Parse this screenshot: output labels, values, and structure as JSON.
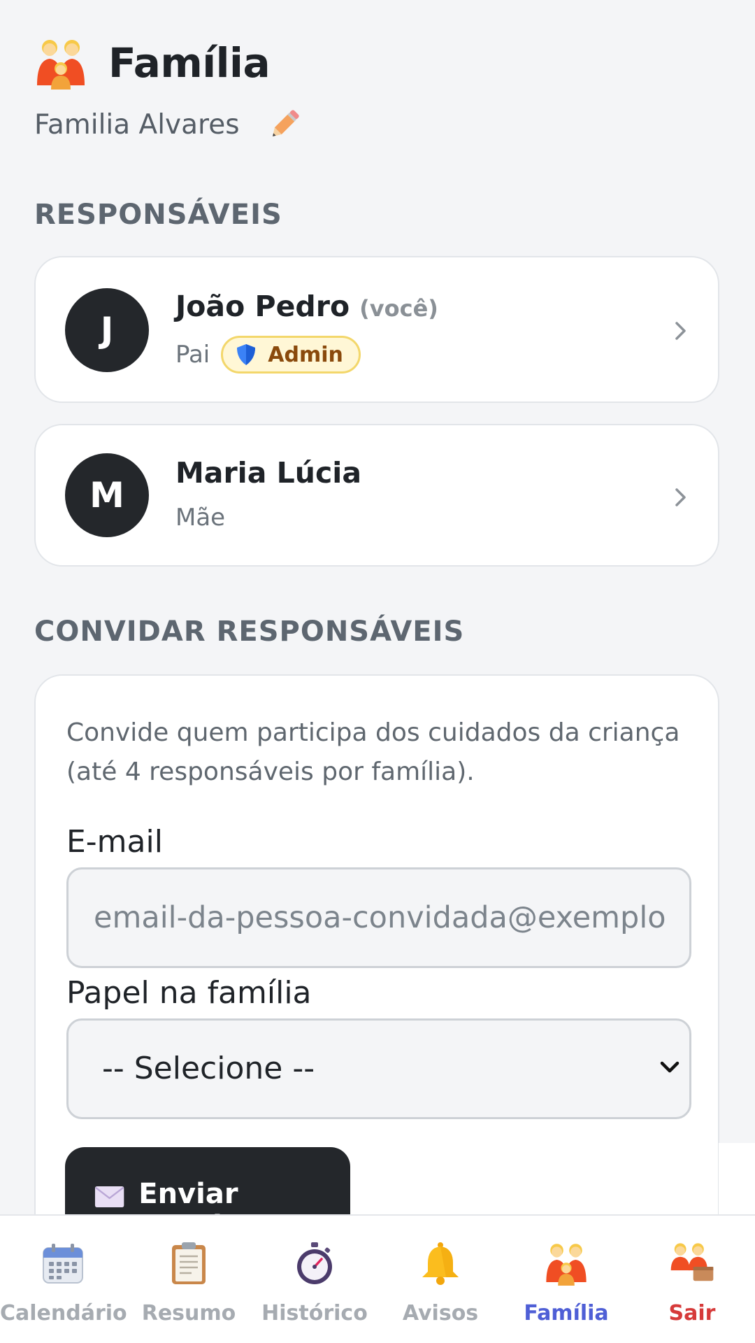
{
  "header": {
    "title": "Família",
    "icon": "family-icon",
    "family_name": "Familia Alvares",
    "edit_icon": "pencil-icon"
  },
  "responsaveis": {
    "section_title": "RESPONSÁVEIS",
    "members": [
      {
        "initial": "J",
        "name": "João Pedro",
        "you_label": "(você)",
        "role": "Pai",
        "badge": "Admin",
        "badge_icon": "shield-icon"
      },
      {
        "initial": "M",
        "name": "Maria Lúcia",
        "role": "Mãe"
      }
    ]
  },
  "invite": {
    "section_title": "CONVIDAR RESPONSÁVEIS",
    "description": "Convide quem participa dos cuidados da criança (até 4 responsáveis por família).",
    "email_label": "E-mail",
    "email_placeholder": "email-da-pessoa-convidada@exemplo.com",
    "role_label": "Papel na família",
    "role_selected": "-- Selecione --",
    "send_label": "Enviar convite",
    "send_icon": "envelope-icon"
  },
  "bottom_nav": {
    "items": [
      {
        "label": "Calendário",
        "icon": "calendar-icon"
      },
      {
        "label": "Resumo",
        "icon": "clipboard-icon"
      },
      {
        "label": "Histórico",
        "icon": "stopwatch-icon"
      },
      {
        "label": "Avisos",
        "icon": "bell-icon"
      },
      {
        "label": "Família",
        "icon": "family-icon",
        "active": true
      },
      {
        "label": "Sair",
        "icon": "family-exit-icon"
      }
    ]
  },
  "colors": {
    "active_nav": "#4f5fd6",
    "logout": "#d63a3a",
    "dark": "#24272b",
    "admin_badge_bg": "#fff7d6",
    "admin_badge_border": "#f3d76b"
  }
}
